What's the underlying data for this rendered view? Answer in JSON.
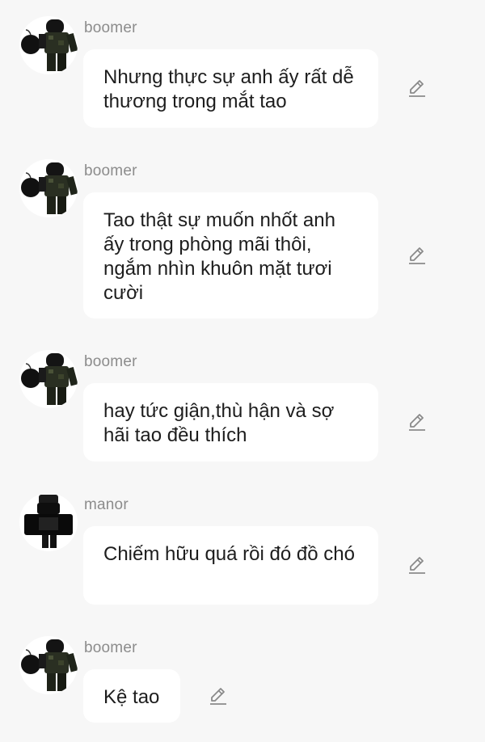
{
  "messages": [
    {
      "sender": "boomer",
      "avatar": "bomb-character-avatar",
      "text": "Nhưng thực sự anh ấy rất dễ thương trong mắt tao",
      "action_icon": "edit-pencil-icon"
    },
    {
      "sender": "boomer",
      "avatar": "bomb-character-avatar",
      "text": "Tao thật sự muốn nhốt anh ấy trong phòng mãi thôi, ngắm nhìn khuôn mặt tươi cười",
      "action_icon": "edit-pencil-icon"
    },
    {
      "sender": "boomer",
      "avatar": "bomb-character-avatar",
      "text": "hay tức giận,thù hận và sợ hãi tao đều thích",
      "action_icon": "edit-pencil-icon"
    },
    {
      "sender": "manor",
      "avatar": "dark-character-avatar",
      "text": "Chiếm hữu quá rồi đó đồ chó",
      "action_icon": "edit-pencil-icon"
    },
    {
      "sender": "boomer",
      "avatar": "bomb-character-avatar",
      "text": "Kệ tao",
      "action_icon": "edit-pencil-icon"
    }
  ],
  "colors": {
    "background": "#f7f7f7",
    "bubble": "#ffffff",
    "sender_name": "#8c8c8c",
    "message_text": "#1d1d1d",
    "icon": "#8a8a8a"
  }
}
